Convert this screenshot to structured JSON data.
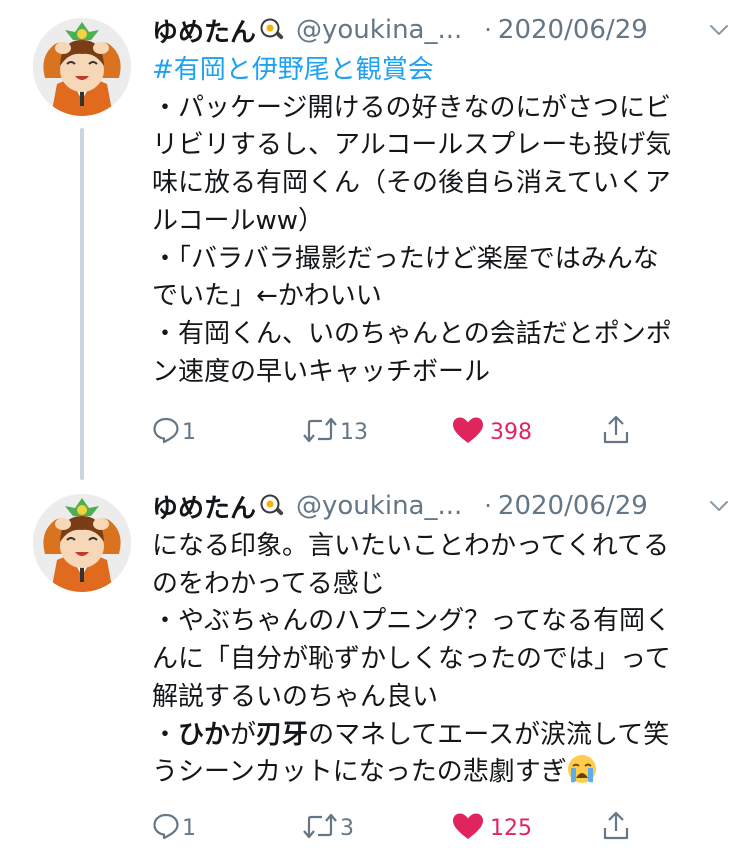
{
  "tweets": [
    {
      "display_name": "ゆめたん",
      "name_emoji": "frying-pan-egg-icon",
      "handle": "@youkina_...",
      "dot": "·",
      "date": "2020/06/29",
      "hashtag": "#有岡と伊野尾と観賞会",
      "lines": [
        "・パッケージ開けるの好きなのにがさつにビ",
        "リビリするし、アルコールスプレーも投げ気",
        "味に放る有岡くん（その後自ら消えていくア",
        "ルコールww）",
        "・「バラバラ撮影だったけど楽屋ではみんな",
        "でいた」←かわいい",
        "・有岡くん、いのちゃんとの会話だとポンポ",
        "ン速度の早いキャッチボール"
      ],
      "replies": "1",
      "retweets": "13",
      "likes": "398"
    },
    {
      "display_name": "ゆめたん",
      "name_emoji": "frying-pan-egg-icon",
      "handle": "@youkina_...",
      "dot": "·",
      "date": "2020/06/29",
      "lines": [
        "になる印象。言いたいことわかってくれてる",
        "のをわかってる感じ",
        "・やぶちゃんのハプニング？ってなる有岡く",
        "んに「自分が恥ずかしくなったのでは」って",
        "解説するいのちゃん良い"
      ],
      "rich_line_1": {
        "a": "・",
        "b": "ひか",
        "c": "が",
        "d": "刃牙",
        "e": "のマネしてエースが涙流して笑"
      },
      "last_line": "うシーンカットになったの悲劇すぎ",
      "last_emoji": "crying-face-icon",
      "replies": "1",
      "retweets": "3",
      "likes": "125"
    }
  ],
  "colors": {
    "text": "#14171a",
    "secondary": "#657786",
    "hashtag": "#1da1f2",
    "like": "#e0245e",
    "thread_line": "#c9d4de"
  }
}
